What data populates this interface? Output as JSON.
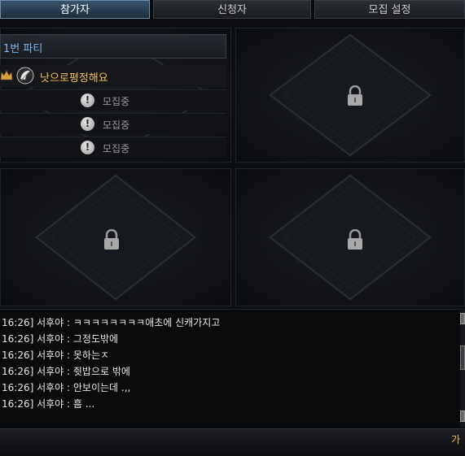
{
  "tabs": [
    {
      "label": "참가자",
      "active": true
    },
    {
      "label": "신청자",
      "active": false
    },
    {
      "label": "모집 설정",
      "active": false
    }
  ],
  "party": {
    "title": "1번 파티",
    "leader": {
      "name": "낫으로평정해요",
      "icon": "crown-icon"
    },
    "slots": [
      {
        "status": "모집중",
        "icon": "exclamation-icon"
      },
      {
        "status": "모집중",
        "icon": "exclamation-icon"
      },
      {
        "status": "모집중",
        "icon": "exclamation-icon"
      }
    ]
  },
  "locked_parties": [
    {
      "icon": "lock-icon"
    },
    {
      "icon": "lock-icon"
    },
    {
      "icon": "lock-icon"
    }
  ],
  "chat": {
    "lines": [
      "16:26] 서후야 : ㅋㅋㅋㅋㅋㅋㅋㅋ애초에 신캐가지고",
      "16:26] 서후야 : 그정도밖에",
      "16:26] 서후야 : 못하는ㅈ",
      "16:26] 서후야 : 쥣밥으로 밖에",
      "16:26] 서후야 : 안보이는데 .,,",
      "16:26] 서후야 : 흠 ..."
    ]
  },
  "input_bar": {
    "label": "가"
  },
  "colors": {
    "accent_blue": "#7cb4ea",
    "leader_gold": "#f0c060",
    "background": "#0d0f12"
  }
}
